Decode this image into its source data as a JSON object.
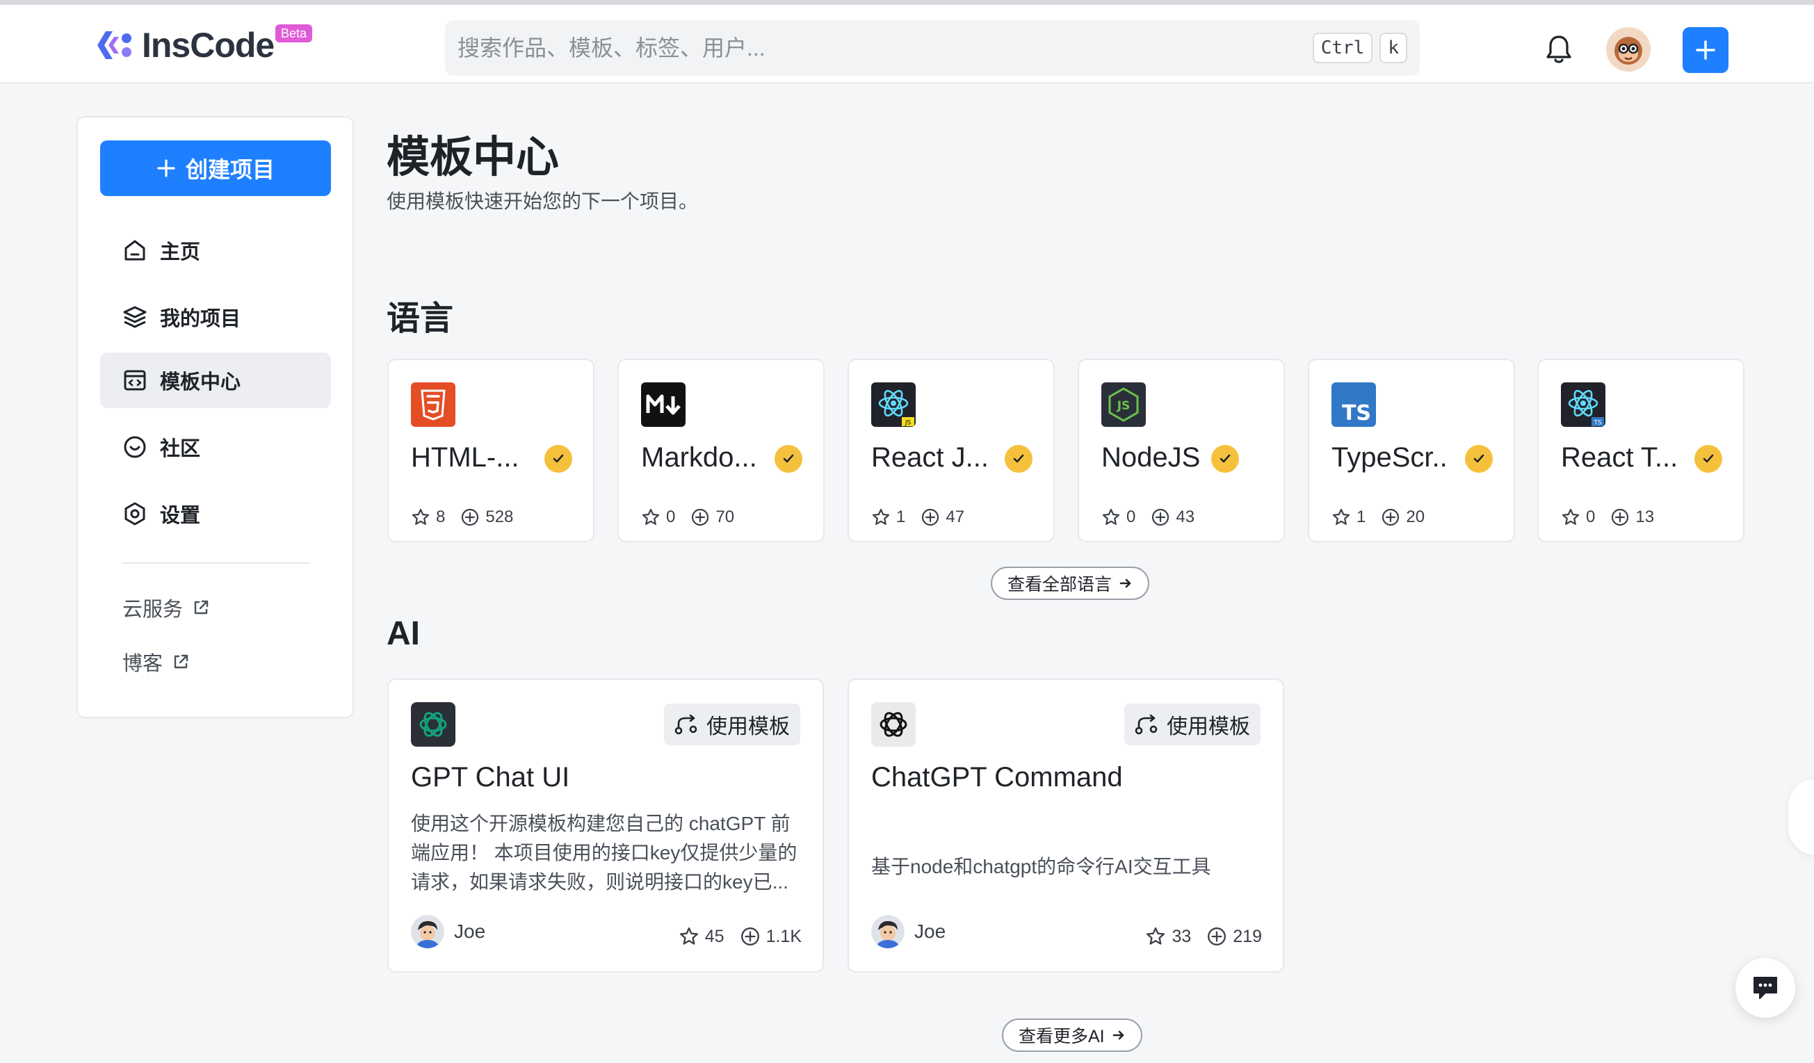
{
  "header": {
    "logo_text": "InsCode",
    "beta_label": "Beta",
    "search_placeholder": "搜索作品、模板、标签、用户...",
    "shortcut_keys": [
      "Ctrl",
      "k"
    ],
    "icons": {
      "notifications": "bell-icon",
      "user": "avatar",
      "create": "plus-icon"
    }
  },
  "sidebar": {
    "create_button": "创建项目",
    "nav": [
      {
        "label": "主页",
        "icon": "home-icon",
        "active": false
      },
      {
        "label": "我的项目",
        "icon": "layers-icon",
        "active": false
      },
      {
        "label": "模板中心",
        "icon": "template-icon",
        "active": true
      },
      {
        "label": "社区",
        "icon": "community-icon",
        "active": false
      },
      {
        "label": "设置",
        "icon": "settings-icon",
        "active": false
      }
    ],
    "external_links": [
      {
        "label": "云服务",
        "icon": "external-link-icon"
      },
      {
        "label": "博客",
        "icon": "external-link-icon"
      }
    ]
  },
  "main": {
    "title": "模板中心",
    "subtitle": "使用模板快速开始您的下一个项目。",
    "language_section": {
      "title": "语言",
      "cards": [
        {
          "name": "HTML-...",
          "icon": "html5-icon",
          "stars": "8",
          "uses": "528"
        },
        {
          "name": "Markdo...",
          "icon": "markdown-icon",
          "stars": "0",
          "uses": "70"
        },
        {
          "name": "React J...",
          "icon": "react-js-icon",
          "stars": "1",
          "uses": "47"
        },
        {
          "name": "NodeJS",
          "icon": "nodejs-icon",
          "stars": "0",
          "uses": "43"
        },
        {
          "name": "TypeScr...",
          "icon": "typescript-icon",
          "stars": "1",
          "uses": "20"
        },
        {
          "name": "React T...",
          "icon": "react-ts-icon",
          "stars": "0",
          "uses": "13"
        }
      ],
      "more_button": "查看全部语言"
    },
    "ai_section": {
      "title": "AI",
      "cards": [
        {
          "title": "GPT Chat UI",
          "icon": "openai-icon",
          "use_label": "使用模板",
          "description": "使用这个开源模板构建您自己的 chatGPT 前端应用！ 本项目使用的接口key仅提供少量的请求，如果请求失败，则说明接口的key已...",
          "author": "Joe",
          "stars": "45",
          "uses": "1.1K"
        },
        {
          "title": "ChatGPT Command",
          "icon": "openai-icon",
          "use_label": "使用模板",
          "description": "基于node和chatgpt的命令行AI交互工具",
          "author": "Joe",
          "stars": "33",
          "uses": "219"
        }
      ],
      "more_button": "查看更多AI"
    }
  },
  "colors": {
    "accent": "#1e80ff",
    "check_badge": "#f5c13c",
    "beta_badge": "#e05bd8"
  }
}
